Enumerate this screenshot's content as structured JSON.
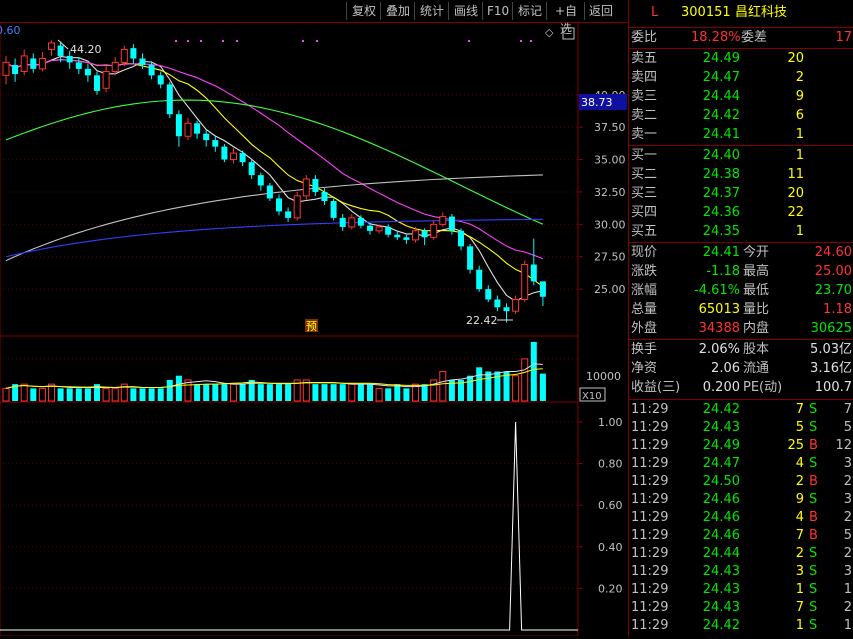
{
  "toolbar": {
    "buttons": [
      "复权",
      "叠加",
      "统计",
      "画线",
      "F10",
      "标记",
      "+自选",
      "返回"
    ]
  },
  "chart": {
    "top_left_value": "0.60",
    "high_label": "44.20",
    "low_label": "22.42",
    "price_tag": "38.73",
    "pre_marker": "预",
    "vol_label": "10000",
    "vol_unit": "X10",
    "price_axis": [
      "40.00",
      "37.50",
      "35.00",
      "32.50",
      "30.00",
      "27.50",
      "25.00"
    ],
    "ind_axis": [
      "1.00",
      "0.80",
      "0.60",
      "0.40",
      "0.20"
    ]
  },
  "chart_data": {
    "type": "candlestick",
    "price_ylim": [
      22.0,
      45.0
    ],
    "indicator_ylim": [
      0,
      1.0
    ],
    "candles": [
      {
        "o": 41.5,
        "c": 42.5,
        "h": 43.0,
        "l": 40.8
      },
      {
        "o": 42.3,
        "c": 41.6,
        "h": 42.8,
        "l": 41.0
      },
      {
        "o": 41.8,
        "c": 43.0,
        "h": 43.5,
        "l": 41.5
      },
      {
        "o": 42.8,
        "c": 42.0,
        "h": 43.2,
        "l": 41.7
      },
      {
        "o": 42.0,
        "c": 42.8,
        "h": 43.3,
        "l": 41.8
      },
      {
        "o": 43.5,
        "c": 44.0,
        "h": 44.2,
        "l": 43.0
      },
      {
        "o": 43.8,
        "c": 43.0,
        "h": 44.1,
        "l": 42.5
      },
      {
        "o": 43.0,
        "c": 42.5,
        "h": 43.4,
        "l": 42.0
      },
      {
        "o": 42.5,
        "c": 42.0,
        "h": 42.9,
        "l": 41.6
      },
      {
        "o": 42.0,
        "c": 41.5,
        "h": 42.4,
        "l": 41.0
      },
      {
        "o": 41.5,
        "c": 40.3,
        "h": 41.8,
        "l": 40.0
      },
      {
        "o": 40.5,
        "c": 41.8,
        "h": 42.2,
        "l": 40.2
      },
      {
        "o": 41.8,
        "c": 42.5,
        "h": 42.9,
        "l": 41.5
      },
      {
        "o": 42.5,
        "c": 43.5,
        "h": 43.8,
        "l": 42.2
      },
      {
        "o": 43.6,
        "c": 42.8,
        "h": 43.9,
        "l": 42.4
      },
      {
        "o": 42.8,
        "c": 42.3,
        "h": 43.2,
        "l": 42.0
      },
      {
        "o": 42.3,
        "c": 41.5,
        "h": 42.6,
        "l": 41.2
      },
      {
        "o": 41.5,
        "c": 40.8,
        "h": 41.8,
        "l": 40.5
      },
      {
        "o": 40.8,
        "c": 38.5,
        "h": 41.0,
        "l": 38.2
      },
      {
        "o": 38.5,
        "c": 36.8,
        "h": 38.8,
        "l": 36.0
      },
      {
        "o": 36.8,
        "c": 37.8,
        "h": 38.2,
        "l": 36.5
      },
      {
        "o": 37.8,
        "c": 37.0,
        "h": 38.0,
        "l": 36.6
      },
      {
        "o": 37.0,
        "c": 36.5,
        "h": 37.3,
        "l": 36.0
      },
      {
        "o": 36.5,
        "c": 36.0,
        "h": 36.8,
        "l": 35.6
      },
      {
        "o": 36.0,
        "c": 35.0,
        "h": 36.2,
        "l": 34.8
      },
      {
        "o": 35.0,
        "c": 35.5,
        "h": 35.9,
        "l": 34.7
      },
      {
        "o": 35.5,
        "c": 34.8,
        "h": 35.7,
        "l": 34.5
      },
      {
        "o": 34.8,
        "c": 33.8,
        "h": 35.0,
        "l": 33.5
      },
      {
        "o": 33.8,
        "c": 33.0,
        "h": 34.0,
        "l": 32.6
      },
      {
        "o": 33.0,
        "c": 32.0,
        "h": 33.2,
        "l": 31.8
      },
      {
        "o": 32.0,
        "c": 31.0,
        "h": 32.3,
        "l": 30.7
      },
      {
        "o": 31.0,
        "c": 30.5,
        "h": 31.3,
        "l": 30.2
      },
      {
        "o": 30.5,
        "c": 32.2,
        "h": 32.5,
        "l": 30.3
      },
      {
        "o": 32.2,
        "c": 33.5,
        "h": 33.8,
        "l": 31.9
      },
      {
        "o": 33.5,
        "c": 32.5,
        "h": 33.8,
        "l": 32.2
      },
      {
        "o": 32.5,
        "c": 31.8,
        "h": 32.8,
        "l": 31.5
      },
      {
        "o": 31.8,
        "c": 30.5,
        "h": 32.0,
        "l": 30.3
      },
      {
        "o": 30.5,
        "c": 29.8,
        "h": 30.8,
        "l": 29.5
      },
      {
        "o": 29.8,
        "c": 30.5,
        "h": 30.8,
        "l": 29.6
      },
      {
        "o": 30.5,
        "c": 29.9,
        "h": 30.7,
        "l": 29.7
      },
      {
        "o": 29.9,
        "c": 29.5,
        "h": 30.1,
        "l": 29.2
      },
      {
        "o": 29.5,
        "c": 29.8,
        "h": 30.0,
        "l": 29.3
      },
      {
        "o": 29.8,
        "c": 29.2,
        "h": 30.0,
        "l": 29.0
      },
      {
        "o": 29.2,
        "c": 29.0,
        "h": 29.5,
        "l": 28.8
      },
      {
        "o": 29.0,
        "c": 28.8,
        "h": 29.3,
        "l": 28.5
      },
      {
        "o": 28.8,
        "c": 29.5,
        "h": 29.8,
        "l": 28.6
      },
      {
        "o": 29.5,
        "c": 29.0,
        "h": 29.7,
        "l": 28.4
      },
      {
        "o": 29.0,
        "c": 30.0,
        "h": 30.3,
        "l": 28.8
      },
      {
        "o": 30.0,
        "c": 30.6,
        "h": 30.9,
        "l": 29.8
      },
      {
        "o": 30.6,
        "c": 29.5,
        "h": 30.8,
        "l": 29.2
      },
      {
        "o": 29.5,
        "c": 28.3,
        "h": 29.7,
        "l": 28.0
      },
      {
        "o": 28.3,
        "c": 26.5,
        "h": 28.5,
        "l": 26.2
      },
      {
        "o": 26.5,
        "c": 25.0,
        "h": 26.8,
        "l": 24.8
      },
      {
        "o": 25.0,
        "c": 24.2,
        "h": 25.3,
        "l": 24.0
      },
      {
        "o": 24.2,
        "c": 23.6,
        "h": 24.5,
        "l": 23.3
      },
      {
        "o": 23.6,
        "c": 23.3,
        "h": 23.9,
        "l": 22.42
      },
      {
        "o": 23.3,
        "c": 24.2,
        "h": 24.5,
        "l": 23.1
      },
      {
        "o": 24.2,
        "c": 26.9,
        "h": 27.2,
        "l": 24.0
      },
      {
        "o": 26.9,
        "c": 25.6,
        "h": 28.9,
        "l": 25.3
      },
      {
        "o": 25.6,
        "c": 24.41,
        "h": 25.0,
        "l": 23.7
      }
    ],
    "volumes": [
      3,
      4,
      4,
      3,
      3,
      4,
      3,
      3,
      3,
      3,
      4,
      3,
      3,
      4,
      3,
      3,
      3,
      3,
      5,
      6,
      5,
      4,
      4,
      4,
      4,
      4,
      4,
      5,
      4,
      4,
      4,
      4,
      5,
      5,
      4,
      4,
      4,
      4,
      4,
      4,
      4,
      3,
      3,
      4,
      3,
      4,
      4,
      5,
      7,
      5,
      5,
      6,
      8,
      7,
      7,
      7,
      6,
      10,
      14,
      6.5
    ],
    "indicator_spike": {
      "index": 56,
      "value": 1.0
    }
  },
  "quote": {
    "flag": "L",
    "code": "300151",
    "name": "昌红科技",
    "weibi_label": "委比",
    "weibi": "18.28%",
    "weicha_label": "委差",
    "weicha": "17",
    "asks": [
      {
        "label": "卖五",
        "price": "24.49",
        "vol": "20"
      },
      {
        "label": "卖四",
        "price": "24.47",
        "vol": "2"
      },
      {
        "label": "卖三",
        "price": "24.44",
        "vol": "9"
      },
      {
        "label": "卖二",
        "price": "24.42",
        "vol": "6"
      },
      {
        "label": "卖一",
        "price": "24.41",
        "vol": "1"
      }
    ],
    "bids": [
      {
        "label": "买一",
        "price": "24.40",
        "vol": "1"
      },
      {
        "label": "买二",
        "price": "24.38",
        "vol": "11"
      },
      {
        "label": "买三",
        "price": "24.37",
        "vol": "20"
      },
      {
        "label": "买四",
        "price": "24.36",
        "vol": "22"
      },
      {
        "label": "买五",
        "price": "24.35",
        "vol": "1"
      }
    ],
    "stats": [
      {
        "l1": "现价",
        "v1": "24.41",
        "l2": "今开",
        "v2": "24.60"
      },
      {
        "l1": "涨跌",
        "v1": "-1.18",
        "l2": "最高",
        "v2": "25.00"
      },
      {
        "l1": "涨幅",
        "v1": "-4.61%",
        "l2": "最低",
        "v2": "23.70"
      },
      {
        "l1": "总量",
        "v1": "65013",
        "l2": "量比",
        "v2": "1.18"
      },
      {
        "l1": "外盘",
        "v1": "34388",
        "l2": "内盘",
        "v2": "30625"
      }
    ],
    "fundamentals": [
      {
        "l1": "换手",
        "v1": "2.06%",
        "l2": "股本",
        "v2": "5.03亿"
      },
      {
        "l1": "净资",
        "v1": "2.06",
        "l2": "流通",
        "v2": "3.16亿"
      },
      {
        "l1": "收益(三)",
        "v1": "0.200",
        "l2": "PE(动)",
        "v2": "100.7"
      }
    ],
    "ticks": [
      {
        "t": "11:29",
        "p": "24.42",
        "v": "7",
        "s": "S",
        "n": "7"
      },
      {
        "t": "11:29",
        "p": "24.43",
        "v": "5",
        "s": "S",
        "n": "5"
      },
      {
        "t": "11:29",
        "p": "24.49",
        "v": "25",
        "s": "B",
        "n": "12"
      },
      {
        "t": "11:29",
        "p": "24.47",
        "v": "4",
        "s": "S",
        "n": "3"
      },
      {
        "t": "11:29",
        "p": "24.50",
        "v": "2",
        "s": "B",
        "n": "2"
      },
      {
        "t": "11:29",
        "p": "24.46",
        "v": "9",
        "s": "S",
        "n": "3"
      },
      {
        "t": "11:29",
        "p": "24.46",
        "v": "4",
        "s": "B",
        "n": "2"
      },
      {
        "t": "11:29",
        "p": "24.46",
        "v": "7",
        "s": "B",
        "n": "5"
      },
      {
        "t": "11:29",
        "p": "24.44",
        "v": "2",
        "s": "S",
        "n": "2"
      },
      {
        "t": "11:29",
        "p": "24.43",
        "v": "3",
        "s": "S",
        "n": "3"
      },
      {
        "t": "11:29",
        "p": "24.43",
        "v": "1",
        "s": "S",
        "n": "1"
      },
      {
        "t": "11:29",
        "p": "24.43",
        "v": "7",
        "s": "S",
        "n": "2"
      },
      {
        "t": "11:29",
        "p": "24.42",
        "v": "1",
        "s": "S",
        "n": "1"
      }
    ]
  }
}
